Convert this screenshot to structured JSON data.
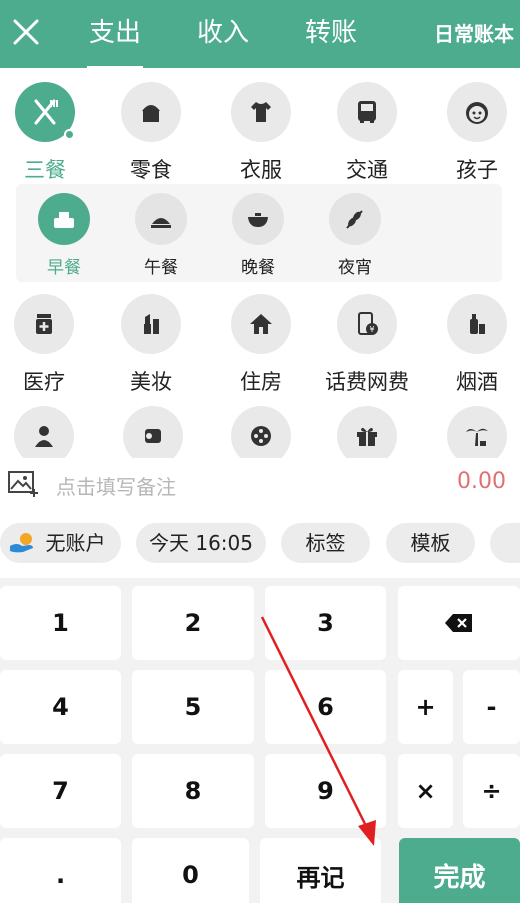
{
  "header": {
    "close_icon": "close-icon",
    "tabs": [
      {
        "label": "支出",
        "active": true
      },
      {
        "label": "收入",
        "active": false
      },
      {
        "label": "转账",
        "active": false
      }
    ],
    "book_label": "日常账本",
    "bg_color": "#4eac8e"
  },
  "categories": {
    "row1": [
      {
        "label": "三餐",
        "icon": "fork-knife-icon",
        "active": true
      },
      {
        "label": "零食",
        "icon": "cupcake-icon"
      },
      {
        "label": "衣服",
        "icon": "shirt-icon"
      },
      {
        "label": "交通",
        "icon": "bus-icon"
      },
      {
        "label": "孩子",
        "icon": "baby-face-icon"
      }
    ],
    "subcategories": [
      {
        "label": "早餐",
        "icon": "breakfast-icon",
        "active": true
      },
      {
        "label": "午餐",
        "icon": "lunch-icon"
      },
      {
        "label": "晚餐",
        "icon": "dinner-bowl-icon"
      },
      {
        "label": "夜宵",
        "icon": "skewer-icon"
      }
    ],
    "row2": [
      {
        "label": "医疗",
        "icon": "medicine-icon"
      },
      {
        "label": "美妆",
        "icon": "lipstick-icon"
      },
      {
        "label": "住房",
        "icon": "house-icon"
      },
      {
        "label": "话费网费",
        "icon": "phone-bill-icon"
      },
      {
        "label": "烟酒",
        "icon": "bottle-icon"
      }
    ],
    "row3": [
      {
        "icon": "person-icon"
      },
      {
        "icon": "tissue-roll-icon"
      },
      {
        "icon": "film-reel-icon"
      },
      {
        "icon": "gift-icon"
      },
      {
        "icon": "palm-tree-icon"
      }
    ]
  },
  "note": {
    "placeholder": "点击填写备注",
    "amount": "0.00",
    "photo_icon": "photo-add-icon"
  },
  "chips": [
    {
      "label": "无账户",
      "icon": "wallet-hand-icon"
    },
    {
      "label": "今天 16:05"
    },
    {
      "label": "标签"
    },
    {
      "label": "模板"
    }
  ],
  "keypad": {
    "keys": {
      "k1": "1",
      "k2": "2",
      "k3": "3",
      "k4": "4",
      "k5": "5",
      "k6": "6",
      "k7": "7",
      "k8": "8",
      "k9": "9",
      "dot": ".",
      "k0": "0",
      "plus": "+",
      "minus": "-",
      "times": "×",
      "divide": "÷",
      "again": "再记",
      "done": "完成"
    },
    "backspace_icon": "backspace-icon"
  },
  "annotation": {
    "arrow_color": "#e02020"
  }
}
